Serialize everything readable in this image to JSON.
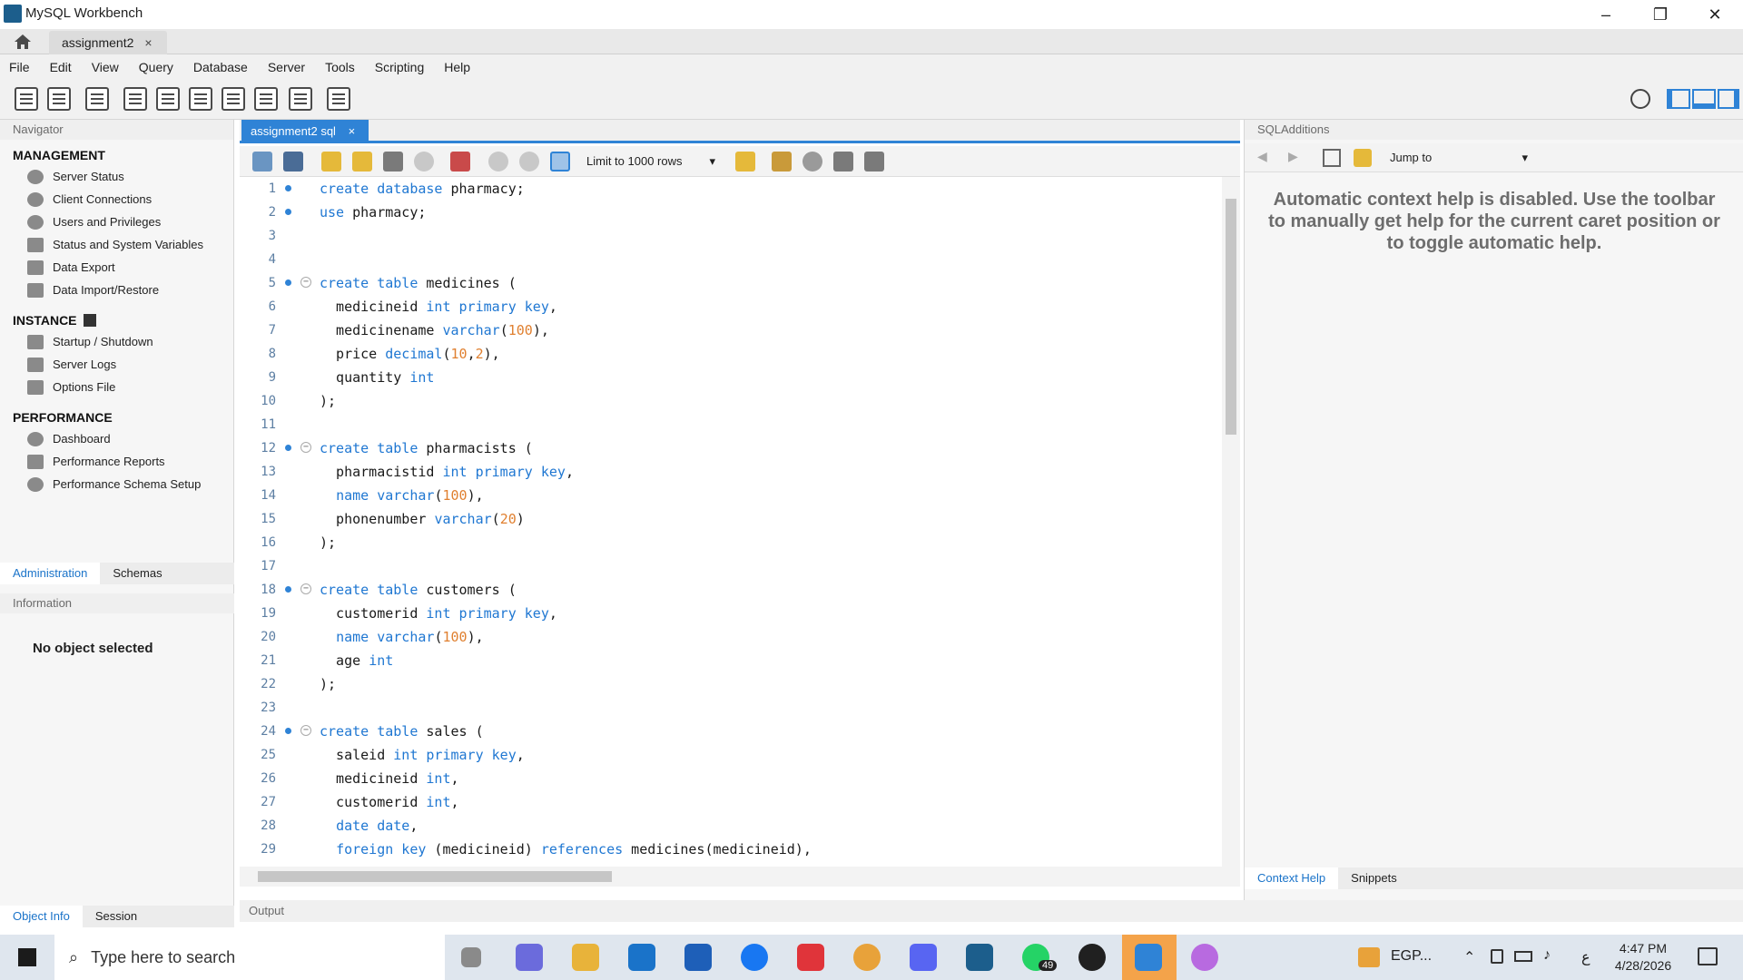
{
  "window": {
    "title": "MySQL Workbench",
    "minimize": "–",
    "maximize": "❐",
    "close": "✕"
  },
  "tabs": {
    "doc_tab": "assignment2",
    "doc_tab_close": "×"
  },
  "menu": [
    "File",
    "Edit",
    "View",
    "Query",
    "Database",
    "Server",
    "Tools",
    "Scripting",
    "Help"
  ],
  "navigator": {
    "header": "Navigator",
    "management_title": "MANAGEMENT",
    "management": [
      "Server Status",
      "Client Connections",
      "Users and Privileges",
      "Status and System Variables",
      "Data Export",
      "Data Import/Restore"
    ],
    "instance_title": "INSTANCE",
    "instance": [
      "Startup / Shutdown",
      "Server Logs",
      "Options File"
    ],
    "performance_title": "PERFORMANCE",
    "performance": [
      "Dashboard",
      "Performance Reports",
      "Performance Schema Setup"
    ],
    "tab_admin": "Administration",
    "tab_schemas": "Schemas",
    "info_header": "Information",
    "no_object": "No object selected",
    "tab_object_info": "Object Info",
    "tab_session": "Session"
  },
  "editor": {
    "tab_label": "assignment2 sql",
    "tab_close": "×",
    "limit_label": "Limit to 1000 rows",
    "lines": [
      {
        "n": "1",
        "dot": true,
        "fold": false,
        "html": "<span class='kw'>create database</span> pharmacy;"
      },
      {
        "n": "2",
        "dot": true,
        "fold": false,
        "html": "<span class='kw'>use</span> pharmacy;"
      },
      {
        "n": "3",
        "dot": false,
        "fold": false,
        "html": ""
      },
      {
        "n": "4",
        "dot": false,
        "fold": false,
        "html": ""
      },
      {
        "n": "5",
        "dot": true,
        "fold": true,
        "html": "<span class='kw'>create table</span> medicines ("
      },
      {
        "n": "6",
        "dot": false,
        "fold": false,
        "html": "  medicineid <span class='kw'>int primary key</span>,"
      },
      {
        "n": "7",
        "dot": false,
        "fold": false,
        "html": "  medicinename <span class='kw'>varchar</span>(<span class='num'>100</span>),"
      },
      {
        "n": "8",
        "dot": false,
        "fold": false,
        "html": "  price <span class='kw'>decimal</span>(<span class='num'>10</span>,<span class='num'>2</span>),"
      },
      {
        "n": "9",
        "dot": false,
        "fold": false,
        "html": "  quantity <span class='kw'>int</span>"
      },
      {
        "n": "10",
        "dot": false,
        "fold": false,
        "html": ");"
      },
      {
        "n": "11",
        "dot": false,
        "fold": false,
        "html": ""
      },
      {
        "n": "12",
        "dot": true,
        "fold": true,
        "html": "<span class='kw'>create table</span> pharmacists ("
      },
      {
        "n": "13",
        "dot": false,
        "fold": false,
        "html": "  pharmacistid <span class='kw'>int primary key</span>,"
      },
      {
        "n": "14",
        "dot": false,
        "fold": false,
        "html": "  <span class='kw'>name varchar</span>(<span class='num'>100</span>),"
      },
      {
        "n": "15",
        "dot": false,
        "fold": false,
        "html": "  phonenumber <span class='kw'>varchar</span>(<span class='num'>20</span>)"
      },
      {
        "n": "16",
        "dot": false,
        "fold": false,
        "html": ");"
      },
      {
        "n": "17",
        "dot": false,
        "fold": false,
        "html": ""
      },
      {
        "n": "18",
        "dot": true,
        "fold": true,
        "html": "<span class='kw'>create table</span> customers ("
      },
      {
        "n": "19",
        "dot": false,
        "fold": false,
        "html": "  customerid <span class='kw'>int primary key</span>,"
      },
      {
        "n": "20",
        "dot": false,
        "fold": false,
        "html": "  <span class='kw'>name varchar</span>(<span class='num'>100</span>),"
      },
      {
        "n": "21",
        "dot": false,
        "fold": false,
        "html": "  age <span class='kw'>int</span>"
      },
      {
        "n": "22",
        "dot": false,
        "fold": false,
        "html": ");"
      },
      {
        "n": "23",
        "dot": false,
        "fold": false,
        "html": ""
      },
      {
        "n": "24",
        "dot": true,
        "fold": true,
        "html": "<span class='kw'>create table</span> sales ("
      },
      {
        "n": "25",
        "dot": false,
        "fold": false,
        "html": "  saleid <span class='kw'>int primary key</span>,"
      },
      {
        "n": "26",
        "dot": false,
        "fold": false,
        "html": "  medicineid <span class='kw'>int</span>,"
      },
      {
        "n": "27",
        "dot": false,
        "fold": false,
        "html": "  customerid <span class='kw'>int</span>,"
      },
      {
        "n": "28",
        "dot": false,
        "fold": false,
        "html": "  <span class='kw'>date date</span>,"
      },
      {
        "n": "29",
        "dot": false,
        "fold": false,
        "html": "  <span class='kw'>foreign key</span> (medicineid) <span class='kw'>references</span> medicines(medicineid),"
      }
    ],
    "output_label": "Output"
  },
  "sql_additions": {
    "header": "SQLAdditions",
    "jump_to": "Jump to",
    "help_text": "Automatic context help is disabled. Use the toolbar to manually get help for the current caret position or to toggle automatic help.",
    "tab_context_help": "Context Help",
    "tab_snippets": "Snippets"
  },
  "taskbar": {
    "search_placeholder": "Type here to search",
    "whatsapp_badge": "49",
    "currency": "EGP...",
    "lang": "ع",
    "time": "4:47 PM",
    "date": "4/28/2026"
  }
}
